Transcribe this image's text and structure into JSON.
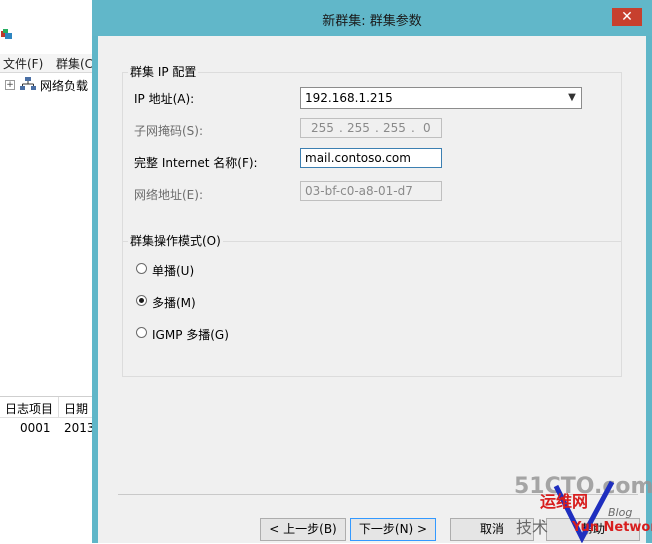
{
  "background_window": {
    "menu": [
      "文件(F)",
      "群集(C"
    ],
    "tree_item": "网络负载",
    "log_columns": [
      "日志项目",
      "日期"
    ],
    "log_row": [
      "0001",
      "2013"
    ]
  },
  "dialog": {
    "title": "新群集: 群集参数",
    "close_glyph": "✕",
    "ip_group": {
      "title": "群集 IP 配置",
      "ip_label": "IP 地址(A):",
      "ip_value": "192.168.1.215",
      "mask_label": "子网掩码(S):",
      "mask_octets": [
        "255",
        "255",
        "255",
        "0"
      ],
      "fqdn_label": "完整 Internet 名称(F):",
      "fqdn_value": "mail.contoso.com",
      "netaddr_label": "网络地址(E):",
      "netaddr_value": "03-bf-c0-a8-01-d7"
    },
    "mode_group": {
      "title": "群集操作模式(O)",
      "options": [
        {
          "label": "单播(U)",
          "selected": false
        },
        {
          "label": "多播(M)",
          "selected": true
        },
        {
          "label": "IGMP 多播(G)",
          "selected": false
        }
      ]
    },
    "buttons": {
      "back": "< 上一步(B)",
      "next": "下一步(N) >",
      "cancel": "取消",
      "help": "帮助"
    }
  },
  "watermark": {
    "site": "51CTO.com",
    "cn": "运维网",
    "blog": "Blog",
    "network": "Yun Network",
    "tech": "技术"
  }
}
